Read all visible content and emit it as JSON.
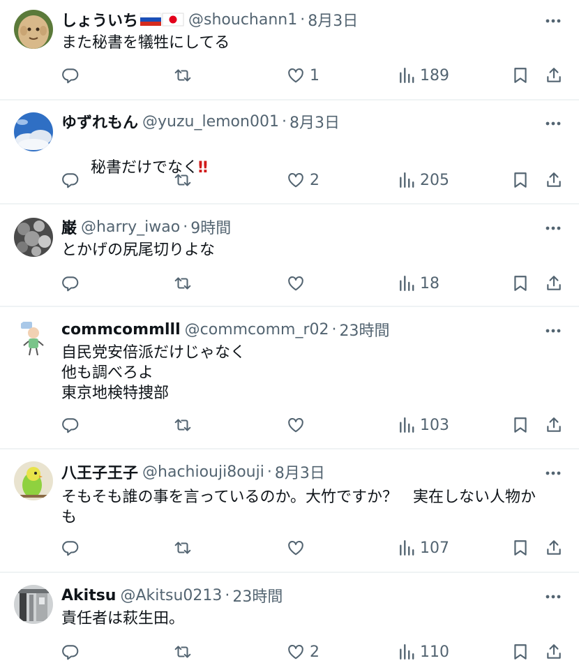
{
  "tweets": [
    {
      "username": "しょういち",
      "has_flags": true,
      "handle": "@shouchann1",
      "sep": "·",
      "time": "8月3日",
      "text": "また秘書を犠牲にしてる",
      "likes": "1",
      "views": "189",
      "avatar_icon": "cartoon-face-avatar"
    },
    {
      "username": "ゆずれもん",
      "handle": "@yuzu_lemon001",
      "sep": "·",
      "time": "8月3日",
      "text": "秘書だけでなく",
      "emoji": "‼",
      "likes": "2",
      "views": "205",
      "avatar_icon": "sky-clouds-avatar"
    },
    {
      "username": "巌",
      "handle": "@harry_iwao",
      "sep": "·",
      "time": "9時間",
      "text": "とかげの尻尾切りよな",
      "likes": "",
      "views": "18",
      "avatar_icon": "blossom-photo-avatar"
    },
    {
      "username": "commcommlll",
      "handle": "@commcomm_r02",
      "sep": "·",
      "time": "23時間",
      "text": "自民党安倍派だけじゃなく\n他も調べろよ\n東京地検特捜部",
      "likes": "",
      "views": "103",
      "avatar_icon": "character-avatar"
    },
    {
      "username": "八王子王子",
      "handle": "@hachiouji8ouji",
      "sep": "·",
      "time": "8月3日",
      "text": "そもそも誰の事を言っているのか。大竹ですか？　実在しない人物か\nも",
      "likes": "",
      "views": "107",
      "avatar_icon": "parakeet-avatar"
    },
    {
      "username": "Akitsu",
      "handle": "@Akitsu0213",
      "sep": "·",
      "time": "23時間",
      "text": "責任者は萩生田。",
      "likes": "2",
      "views": "110",
      "avatar_icon": "building-photo-avatar"
    }
  ],
  "colors": {
    "text": "#0f1419",
    "muted": "#536471",
    "divider": "#eff3f4"
  },
  "icons": [
    "reply-icon",
    "retweet-icon",
    "like-icon",
    "views-icon",
    "bookmark-icon",
    "share-icon",
    "more-icon"
  ]
}
